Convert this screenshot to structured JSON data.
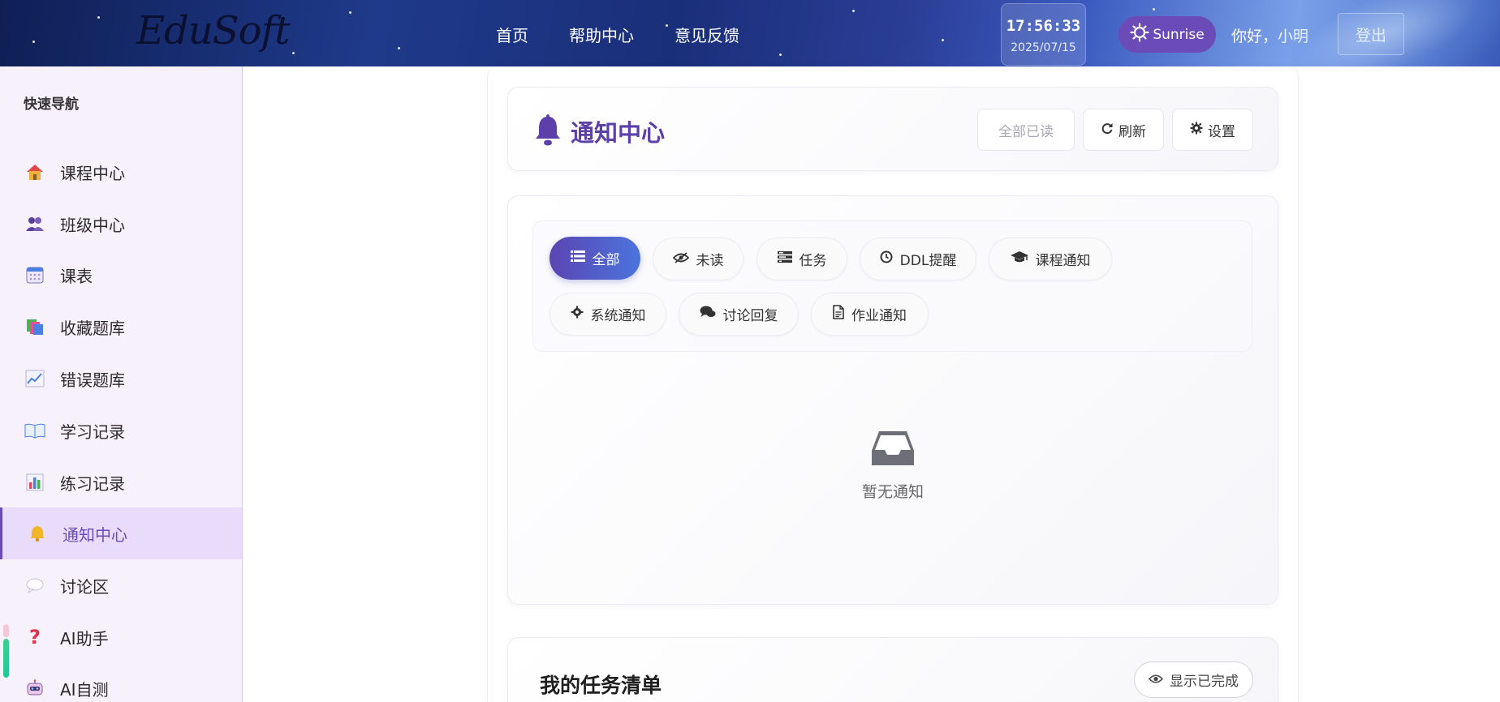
{
  "header": {
    "logo": "EduSoft",
    "nav": [
      "首页",
      "帮助中心",
      "意见反馈"
    ],
    "clock_time": "17:56:33",
    "clock_date": "2025/07/15",
    "theme_label": "Sunrise",
    "greeting": "你好，小明",
    "logout_label": "登出"
  },
  "sidebar": {
    "title": "快速导航",
    "items": [
      {
        "label": "课程中心",
        "icon": "house-icon"
      },
      {
        "label": "班级中心",
        "icon": "users-icon"
      },
      {
        "label": "课表",
        "icon": "calendar-icon"
      },
      {
        "label": "收藏题库",
        "icon": "bookmark-tabs-icon"
      },
      {
        "label": "错误题库",
        "icon": "chart-line-icon"
      },
      {
        "label": "学习记录",
        "icon": "open-book-icon"
      },
      {
        "label": "练习记录",
        "icon": "bar-chart-icon"
      },
      {
        "label": "通知中心",
        "icon": "bell-icon",
        "active": true
      },
      {
        "label": "讨论区",
        "icon": "speech-bubble-icon"
      },
      {
        "label": "AI助手",
        "icon": "question-mark-icon"
      },
      {
        "label": "AI自测",
        "icon": "robot-icon"
      }
    ]
  },
  "main": {
    "title": "通知中心",
    "actions": {
      "mark_all_read": "全部已读",
      "refresh": "刷新",
      "settings": "设置"
    },
    "filters": [
      "全部",
      "未读",
      "任务",
      "DDL提醒",
      "课程通知",
      "系统通知",
      "讨论回复",
      "作业通知"
    ],
    "active_filter": "全部",
    "empty_message": "暂无通知",
    "task_list_title": "我的任务清单",
    "show_done_label": "显示已完成"
  },
  "colors": {
    "accent": "#6a4bb8",
    "active_bg": "#e8dcfa",
    "chip_gradient_start": "#5b45b2",
    "chip_gradient_end": "#4c74dd"
  }
}
